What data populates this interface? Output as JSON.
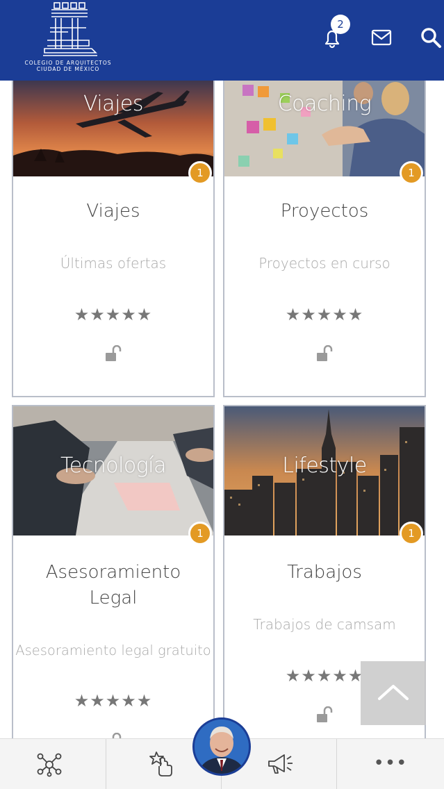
{
  "header": {
    "logo_line1": "COLEGIO DE ARQUITECTOS",
    "logo_line2": "CIUDAD DE MÉXICO",
    "notification_count": "2",
    "icons": [
      "bell-icon",
      "mail-icon",
      "search-icon"
    ]
  },
  "cards": [
    {
      "image_label": "Viajes",
      "title": "Viajes",
      "subtitle": "Últimas ofertas",
      "count": "1",
      "stars": "★★★★★"
    },
    {
      "image_label": "Coaching",
      "title": "Proyectos",
      "subtitle": "Proyectos en curso",
      "count": "1",
      "stars": "★★★★★"
    },
    {
      "image_label": "Tecnología",
      "title_line1": "Asesoramiento",
      "title_line2": "Legal",
      "subtitle": "Asesoramiento legal gratuito",
      "count": "1",
      "stars": "★★★★★"
    },
    {
      "image_label": "Lifestyle",
      "title": "Trabajos",
      "subtitle": "Trabajos de camsam",
      "count": "1",
      "stars": "★★★★★"
    }
  ],
  "bottom_bar": {
    "items": [
      "network-icon",
      "touch-icon",
      "profile-avatar",
      "megaphone-icon",
      "more-icon"
    ],
    "more_label": "•••"
  },
  "colors": {
    "header_bg": "#1b3d96",
    "badge": "#e39a24",
    "star": "#777777"
  }
}
